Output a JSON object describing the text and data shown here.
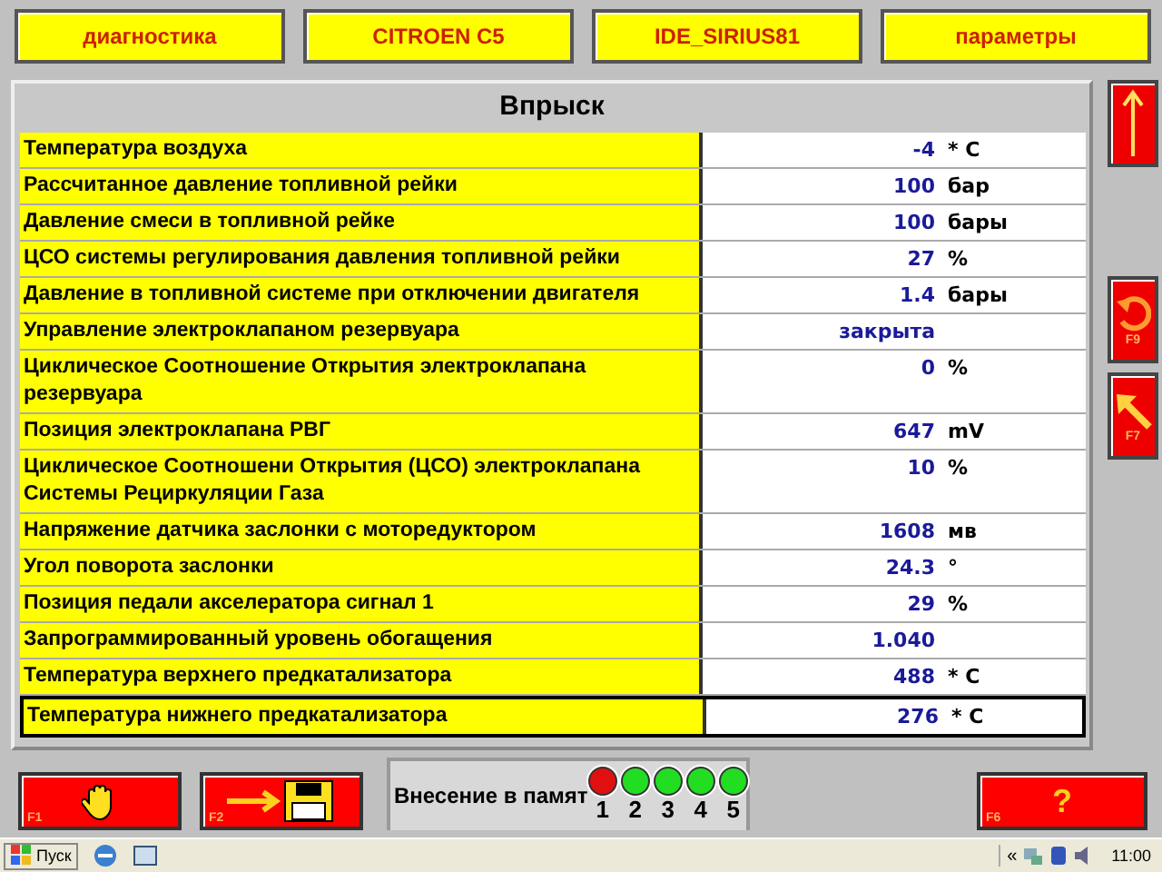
{
  "top_tabs": [
    {
      "label": "диагностика"
    },
    {
      "label": "CITROEN C5"
    },
    {
      "label": "IDE_SIRIUS81"
    },
    {
      "label": "параметры"
    }
  ],
  "panel": {
    "title": "Впрыск"
  },
  "rows": [
    {
      "label": "Температура воздуха",
      "value": "-4",
      "unit": "* C",
      "selected": false
    },
    {
      "label": "Рассчитанное давление топливной рейки",
      "value": "100",
      "unit": "бар",
      "selected": false
    },
    {
      "label": "Давление смеси в топливной рейке",
      "value": "100",
      "unit": "бары",
      "selected": false
    },
    {
      "label": "ЦСО системы регулирования давления топливной рейки",
      "value": "27",
      "unit": "%",
      "selected": false
    },
    {
      "label": "Давление в топливной системе при отключении двигателя",
      "value": "1.4",
      "unit": "бары",
      "selected": false
    },
    {
      "label": "Управление электроклапаном резервуара",
      "value": "закрыта",
      "selected": false
    },
    {
      "label": "Циклическое Соотношение Открытия электроклапана резервуара",
      "value": "0",
      "unit": "%",
      "selected": false
    },
    {
      "label": "Позиция электроклапана РВГ",
      "value": "647",
      "unit": "mV",
      "selected": false
    },
    {
      "label": "Циклическое Соотношени Открытия (ЦСО) электроклапана Системы Рециркуляции Газа",
      "value": "10",
      "unit": "%",
      "selected": false
    },
    {
      "label": "Напряжение датчика заслонки с моторедуктором",
      "value": "1608",
      "unit": "мв",
      "selected": false
    },
    {
      "label": "Угол поворота заслонки",
      "value": "24.3",
      "unit": "°",
      "selected": false
    },
    {
      "label": "Позиция педали акселератора сигнал 1",
      "value": "29",
      "unit": "%",
      "selected": false
    },
    {
      "label": "Запрограммированный уровень обогащения",
      "value": "1.040",
      "selected": false
    },
    {
      "label": "Температура верхнего предкатализатора",
      "value": "488",
      "unit": "* C",
      "selected": false
    },
    {
      "label": "Температура нижнего предкатализатора",
      "value": "276",
      "unit": "* C",
      "selected": true
    }
  ],
  "side_buttons": [
    {
      "kind": "up"
    },
    {
      "kind": "back",
      "key": "F9"
    },
    {
      "kind": "home",
      "key": "F7"
    }
  ],
  "bottom_buttons": [
    {
      "kind": "stop",
      "key": "F1"
    },
    {
      "kind": "save",
      "key": "F2"
    },
    {
      "kind": "help",
      "key": "F6",
      "symbol": "?"
    }
  ],
  "memory": {
    "label": "Внесение в памят",
    "slots": [
      {
        "number": "1",
        "color": "#e01010"
      },
      {
        "number": "2",
        "color": "#22dd22"
      },
      {
        "number": "3",
        "color": "#22dd22"
      },
      {
        "number": "4",
        "color": "#22dd22"
      },
      {
        "number": "5",
        "color": "#22dd22"
      }
    ]
  },
  "taskbar": {
    "start": "Пуск",
    "chevron": "«",
    "clock": "11:00"
  }
}
